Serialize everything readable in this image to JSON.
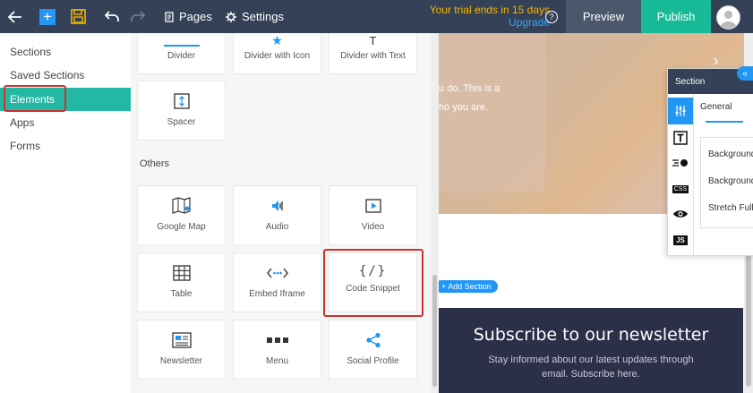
{
  "topbar": {
    "pages_label": "Pages",
    "settings_label": "Settings",
    "trial_text": "Your trial ends in 15 days",
    "upgrade_label": "Upgrade",
    "preview_label": "Preview",
    "publish_label": "Publish"
  },
  "sidebar": {
    "items": [
      {
        "label": "Sections"
      },
      {
        "label": "Saved Sections"
      },
      {
        "label": "Elements",
        "active": true
      },
      {
        "label": "Apps"
      },
      {
        "label": "Forms"
      }
    ]
  },
  "elements": {
    "top_row": [
      {
        "label": "Divider",
        "icon": "divider-icon"
      },
      {
        "label": "Divider with Icon",
        "icon": "star-icon"
      },
      {
        "label": "Divider with Text",
        "icon": "text-icon"
      }
    ],
    "spacer": {
      "label": "Spacer",
      "icon": "spacer-icon"
    },
    "others_heading": "Others",
    "others": [
      {
        "label": "Google Map",
        "icon": "map-icon"
      },
      {
        "label": "Audio",
        "icon": "audio-icon"
      },
      {
        "label": "Video",
        "icon": "video-icon"
      },
      {
        "label": "Table",
        "icon": "table-icon"
      },
      {
        "label": "Embed Iframe",
        "icon": "iframe-icon"
      },
      {
        "label": "Code Snippet",
        "icon": "code-icon",
        "glyph": "{/}"
      },
      {
        "label": "Newsletter",
        "icon": "newsletter-icon"
      },
      {
        "label": "Menu",
        "icon": "menu-icon"
      },
      {
        "label": "Social Profile",
        "icon": "share-icon"
      }
    ]
  },
  "canvas": {
    "hero_line1": "u do. This is a",
    "hero_line2": "ho you are.",
    "add_section_label": "+ Add Section",
    "newsletter_title": "Subscribe to our newsletter",
    "newsletter_line1": "Stay informed about our latest updates through",
    "newsletter_line2": "email. Subscribe here."
  },
  "section_panel": {
    "title": "Section",
    "general_tab": "General",
    "options": [
      "Background",
      "Background",
      "Stretch Full"
    ],
    "side_icons": [
      "sliders-icon",
      "text-box-icon",
      "speed-icon",
      "css-icon",
      "eye-icon",
      "js-icon"
    ],
    "css_label": "CSS",
    "js_label": "JS"
  },
  "colors": {
    "topbar": "#344156",
    "accent": "#22b8a4",
    "publish": "#17b996",
    "blue": "#2196f3",
    "trial": "#f4b400",
    "highlight": "#d32f2f",
    "newsletter_bg": "#2b2f48"
  }
}
